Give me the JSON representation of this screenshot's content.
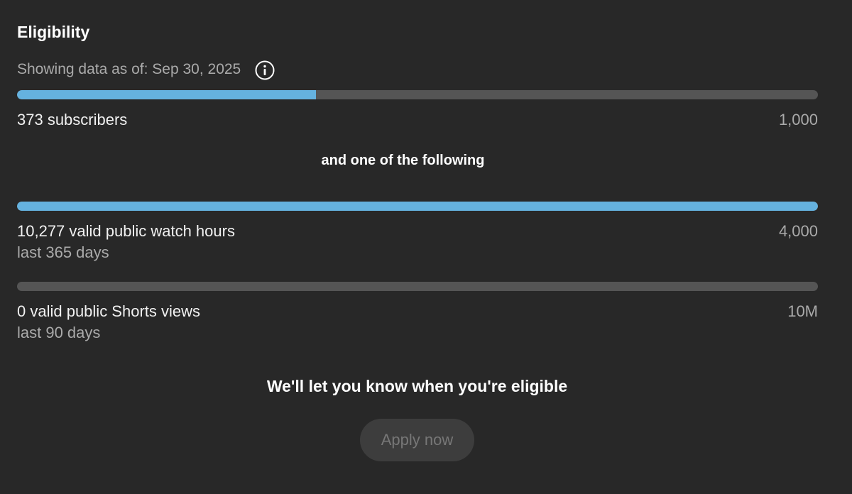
{
  "header": {
    "title": "Eligibility",
    "as_of": "Showing data as of: Sep 30, 2025"
  },
  "requirements": {
    "subscribers": {
      "label": "373 subscribers",
      "target": "1,000",
      "progress": 0.373
    },
    "connector": "and one of the following",
    "watch_hours": {
      "label": "10,277 valid public watch hours",
      "period": "last 365 days",
      "target": "4,000",
      "progress": 1.0
    },
    "shorts_views": {
      "label": "0 valid public Shorts views",
      "period": "last 90 days",
      "target": "10M",
      "progress": 0.0
    }
  },
  "footer": {
    "notice": "We'll let you know when you're eligible",
    "apply_label": "Apply now",
    "apply_enabled": false
  },
  "colors": {
    "background": "#282828",
    "progress_fill": "#65b2df",
    "progress_track": "#555555"
  },
  "icons": {
    "info": "info-icon"
  }
}
